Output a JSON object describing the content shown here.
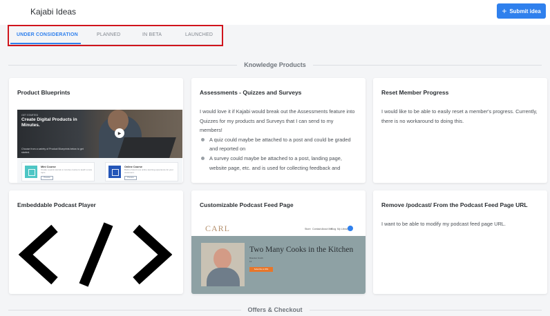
{
  "header": {
    "title": "Kajabi Ideas",
    "submit_label": "Submit idea",
    "submit_icon": "plus-icon"
  },
  "tabs": [
    {
      "label": "UNDER CONSIDERATION",
      "active": true
    },
    {
      "label": "PLANNED",
      "active": false
    },
    {
      "label": "IN BETA",
      "active": false
    },
    {
      "label": "LAUNCHED",
      "active": false
    }
  ],
  "sections": [
    {
      "label": "Knowledge Products"
    },
    {
      "label": "Offers & Checkout"
    }
  ],
  "cards": [
    {
      "title": "Product Blueprints",
      "image": {
        "small_label": "GET STARTED",
        "headline": "Create Digital Products in Minutes.",
        "sub": "Choose from a variety of Product Blueprints below to get started.",
        "tiles": [
          {
            "title": "Mini Course",
            "text": "Create a quick tutorial or concise course to teach a new topic.",
            "btn": "Preview"
          },
          {
            "title": "Online Course",
            "text": "Build a brand new online learning experience for your customers.",
            "btn": "Preview"
          }
        ]
      }
    },
    {
      "title": "Assessments - Quizzes and Surveys",
      "body": "I would love it if Kajabi would break out the Assessments feature into Quizzes for my products and Surveys that I can send to my members!",
      "bullets": [
        "A quiz could maybe be attached to a post and could be graded and reported on",
        "A survey could maybe be attached to a post, landing page, website page, etc. and is used for collecting feedback and"
      ]
    },
    {
      "title": "Reset Member Progress",
      "body": "I would like to be able to easily reset a member's progress. Currently, there is no workaround to doing this."
    },
    {
      "title": "Embeddable Podcast Player"
    },
    {
      "title": "Customizable Podcast Feed Page",
      "image": {
        "brand": "CARL",
        "nav": [
          "Store",
          "Contact",
          "About Me",
          "Blog",
          "My Library"
        ],
        "headline": "Two Many Cooks in the Kitchen",
        "meta": [
          "Brandon Smith",
          "14"
        ],
        "btn": "Subscribe to RSS"
      }
    },
    {
      "title": "Remove /podcast/ From the Podcast Feed Page URL",
      "body": "I want to be able to modify my podcast feed page URL."
    }
  ],
  "colors": {
    "accent": "#2f80ed",
    "highlight": "#d0141c"
  }
}
